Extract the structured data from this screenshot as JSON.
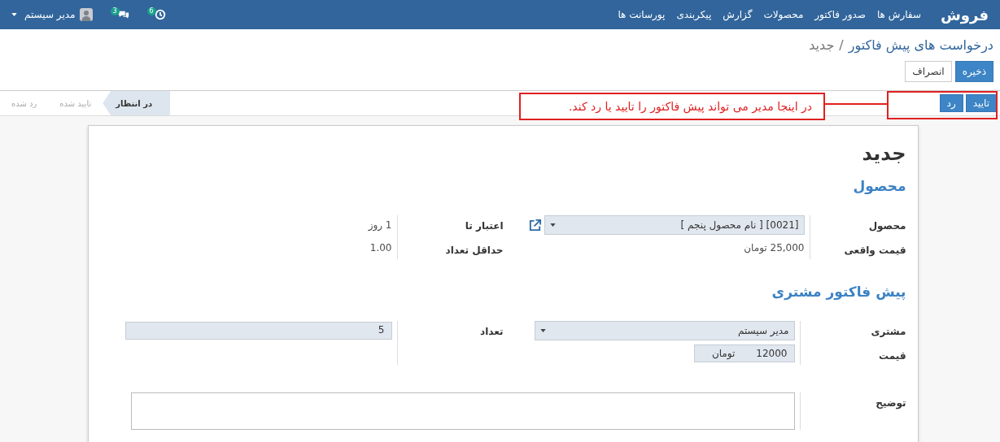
{
  "navbar": {
    "brand": "فروش",
    "menu": [
      {
        "label": "سفارش ها"
      },
      {
        "label": "صدور فاکتور"
      },
      {
        "label": "محصولات"
      },
      {
        "label": "گزارش"
      },
      {
        "label": "پیکربندی"
      },
      {
        "label": "پورسانت ها"
      }
    ],
    "activities": {
      "count": "6"
    },
    "messages": {
      "count": "3"
    },
    "user": {
      "name": "مدیر سیستم"
    }
  },
  "breadcrumb": {
    "parent": "درخواست های پیش فاکتور",
    "separator": "/",
    "current": "جدید"
  },
  "actions": [
    {
      "label": "ذخیره",
      "primary": true
    },
    {
      "label": "انصراف",
      "primary": false
    }
  ],
  "statusbar": {
    "buttons": [
      {
        "label": "تایید"
      },
      {
        "label": "رد"
      }
    ],
    "stages": [
      {
        "label": "در انتظار",
        "selected": true
      },
      {
        "label": "تایید شده",
        "selected": false
      },
      {
        "label": "رد شده",
        "selected": false
      }
    ]
  },
  "annotation": {
    "text": "در اینجا مدیر می تواند پیش فاکتور را تایید یا رد کند."
  },
  "form": {
    "title": "جدید",
    "sections": [
      {
        "heading": "محصول",
        "right": [
          {
            "label": "محصول",
            "kind": "select",
            "value": "[0021] [ نام محصول پنجم ]",
            "link": true
          },
          {
            "label": "قیمت واقعی",
            "kind": "text",
            "value": "25,000 تومان"
          }
        ],
        "left": [
          {
            "label": "اعتبار تا",
            "kind": "text",
            "value": "1 روز"
          },
          {
            "label": "حداقل تعداد",
            "kind": "text",
            "value": "1.00"
          }
        ]
      },
      {
        "heading": "پیش فاکتور مشتری",
        "right": [
          {
            "label": "مشتری",
            "kind": "select",
            "value": "مدیر سیستم"
          },
          {
            "label": "قیمت",
            "kind": "money",
            "value": "12000",
            "currency": "تومان"
          }
        ],
        "left": [
          {
            "label": "تعداد",
            "kind": "input",
            "value": "5"
          }
        ]
      }
    ],
    "description": {
      "label": "توضیح"
    }
  }
}
